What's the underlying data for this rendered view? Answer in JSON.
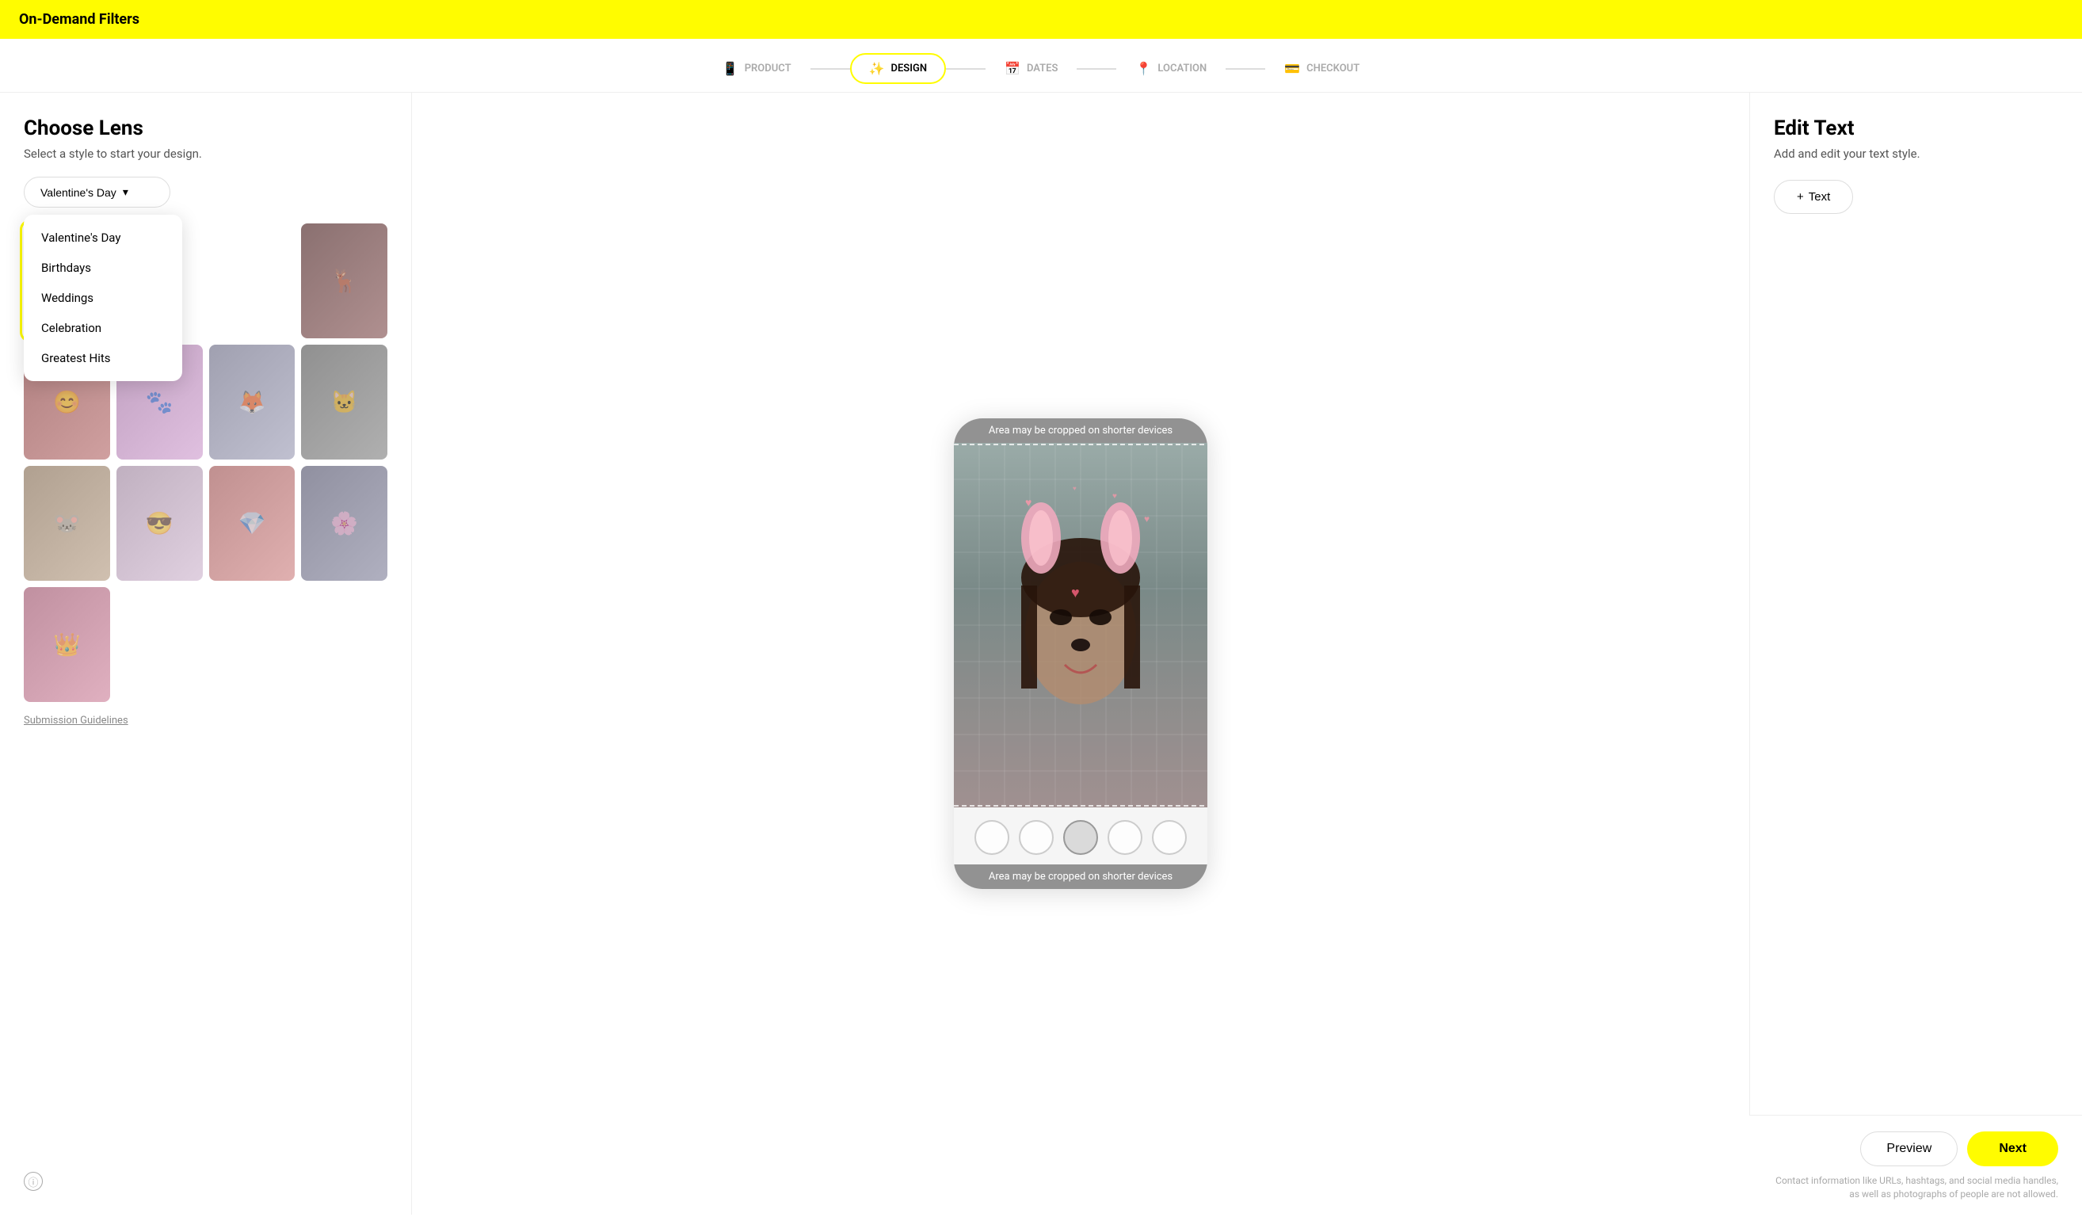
{
  "topbar": {
    "title": "On-Demand Filters"
  },
  "stepper": {
    "steps": [
      {
        "id": "product",
        "label": "PRODUCT",
        "icon": "📱",
        "state": "inactive"
      },
      {
        "id": "design",
        "label": "DESIGN",
        "icon": "✨",
        "state": "active"
      },
      {
        "id": "dates",
        "label": "DATES",
        "icon": "📅",
        "state": "inactive"
      },
      {
        "id": "location",
        "label": "LOCATION",
        "icon": "📍",
        "state": "inactive"
      },
      {
        "id": "checkout",
        "label": "CHECKOUT",
        "icon": "💳",
        "state": "inactive"
      }
    ]
  },
  "left_panel": {
    "title": "Choose Lens",
    "subtitle": "Select a style to start your design.",
    "dropdown": {
      "selected": "Valentine's Day",
      "options": [
        "Valentine's Day",
        "Birthdays",
        "Weddings",
        "Celebration",
        "Greatest Hits"
      ]
    },
    "submission_link": "Submission Guidelines"
  },
  "center_panel": {
    "crop_top": "Area may be cropped on shorter devices",
    "crop_bottom": "Area may be cropped on shorter devices"
  },
  "right_panel": {
    "title": "Edit Text",
    "subtitle": "Add and edit your text style.",
    "add_text_btn": "+ Text",
    "preview_btn": "Preview",
    "next_btn": "Next",
    "disclaimer": "Contact information like URLs, hashtags, and social media\nhandles, as well as photographs of people are not allowed."
  }
}
